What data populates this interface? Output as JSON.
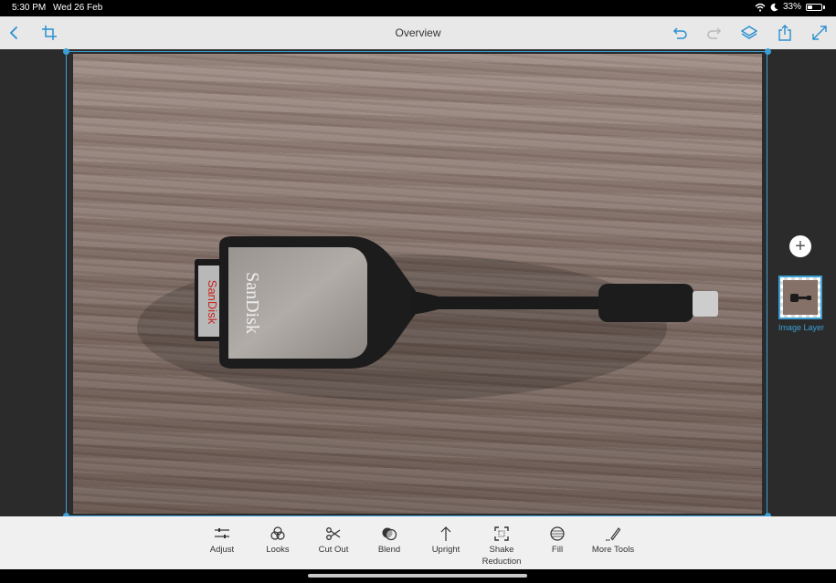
{
  "status": {
    "time": "5:30 PM",
    "date": "Wed 26 Feb",
    "battery": "33%",
    "battery_level": 0.33
  },
  "header": {
    "title": "Overview"
  },
  "colors": {
    "accent": "#3a9fd6",
    "toolbar_bg": "#e8e8e8",
    "workspace_bg": "#2b2b2b"
  },
  "photo": {
    "card_brand": "SanDisk",
    "card_label": "SanDisk"
  },
  "layers": {
    "items": [
      {
        "label": "Image Layer"
      }
    ]
  },
  "tools": [
    {
      "label": "Adjust",
      "icon": "sliders-icon"
    },
    {
      "label": "Looks",
      "icon": "looks-icon"
    },
    {
      "label": "Cut Out",
      "icon": "scissors-icon"
    },
    {
      "label": "Blend",
      "icon": "blend-icon"
    },
    {
      "label": "Upright",
      "icon": "upright-icon"
    },
    {
      "label": "Shake Reduction",
      "label_line1": "Shake",
      "label_line2": "Reduction",
      "icon": "shake-reduction-icon"
    },
    {
      "label": "Fill",
      "icon": "fill-icon"
    },
    {
      "label": "More Tools",
      "icon": "more-tools-icon"
    }
  ]
}
